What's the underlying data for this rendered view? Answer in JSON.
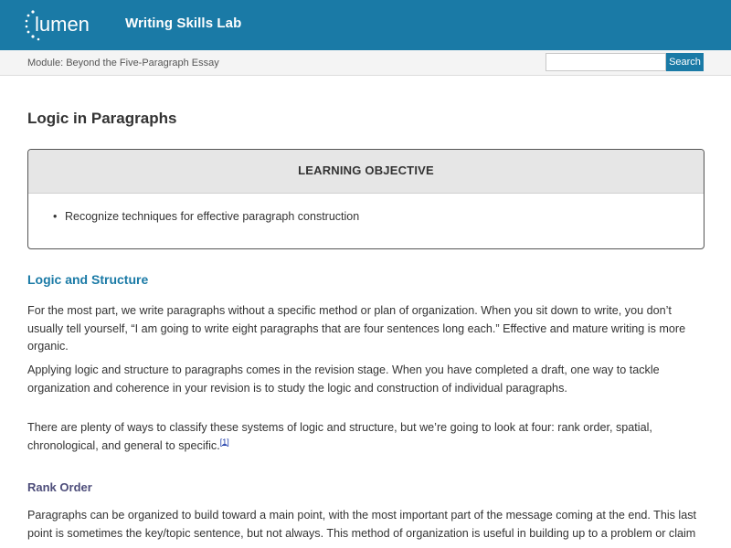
{
  "header": {
    "logo_text": "lumen",
    "course_title": "Writing Skills Lab"
  },
  "subbar": {
    "module": "Module: Beyond the Five-Paragraph Essay",
    "search_placeholder": "",
    "search_label": "Search"
  },
  "main": {
    "title": "Logic in Paragraphs",
    "learning_objective": {
      "heading": "LEARNING OBJECTIVE",
      "items": [
        "Recognize techniques for effective paragraph construction"
      ]
    },
    "section_heading": "Logic and Structure",
    "paragraphs": [
      "For the most part, we write paragraphs without a specific method or plan of organization. When you sit down to write, you don’t usually tell yourself, “I am going to write eight paragraphs that are four sentences long each.” Effective and mature writing is more organic.",
      "Applying logic and structure to paragraphs comes in the revision stage. When you have completed a draft, one way to tackle organization and coherence in your revision is to study the logic and construction of individual paragraphs.",
      "There are plenty of ways to classify these systems of logic and structure, but we’re going to look at four: rank order, spatial, chronological, and general to specific."
    ],
    "footnote_1": "[1]",
    "subheading": "Rank Order",
    "rank_order_paragraph": "Paragraphs can be organized to build toward a main point, with the most important part of the message coming at the end. This last point is sometimes the key/topic sentence, but not always. This method of organization is useful in building up to a problem or claim"
  },
  "colors": {
    "brand": "#1a7aa6",
    "subheading": "#4d4d7a",
    "footnote_link": "#1a3aa8"
  }
}
